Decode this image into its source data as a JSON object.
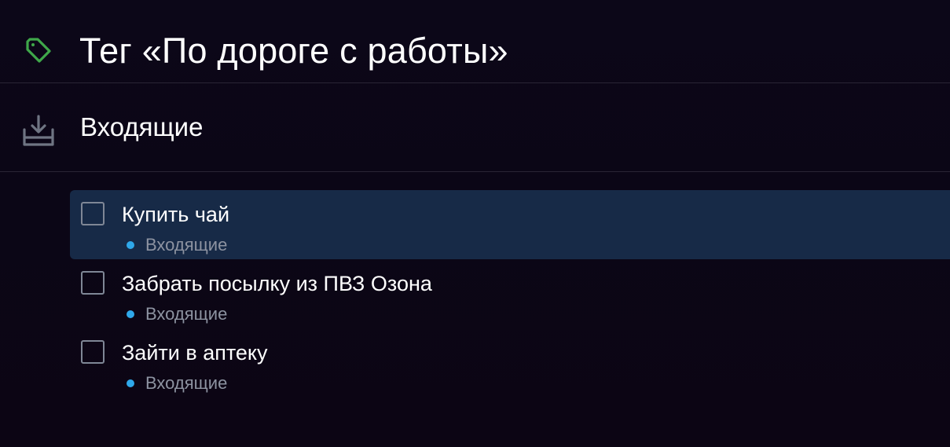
{
  "header": {
    "title": "Тег «По дороге с работы»",
    "icon": "tag-icon",
    "icon_color": "#3fa84a"
  },
  "section": {
    "title": "Входящие",
    "icon": "inbox-icon"
  },
  "tasks": [
    {
      "title": "Купить чай",
      "project": "Входящие",
      "selected": true,
      "completed": false
    },
    {
      "title": "Забрать посылку из ПВЗ Озона",
      "project": "Входящие",
      "selected": false,
      "completed": false
    },
    {
      "title": "Зайти в аптеку",
      "project": "Входящие",
      "selected": false,
      "completed": false
    }
  ],
  "colors": {
    "background": "#0b0616",
    "selected_row": "#172a47",
    "project_dot": "#2fa8ea",
    "divider": "#2a2535"
  }
}
